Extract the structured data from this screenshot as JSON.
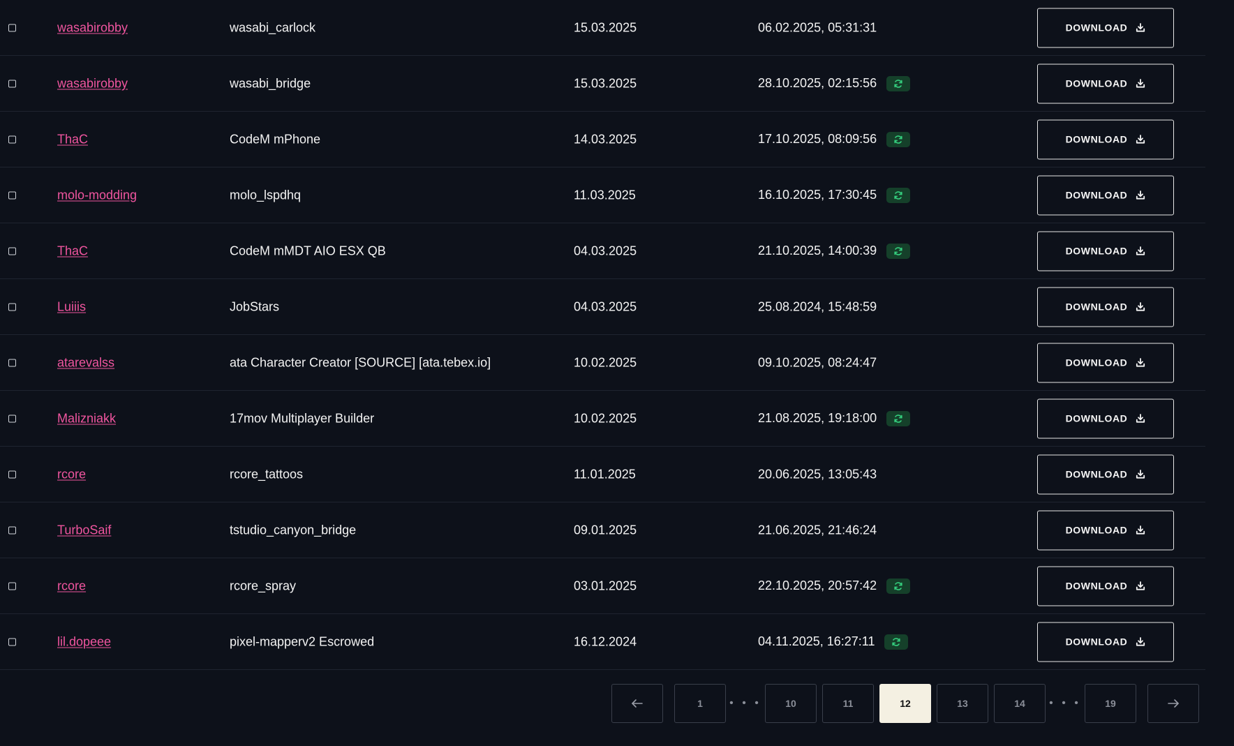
{
  "table": {
    "rows": [
      {
        "author": "wasabirobby",
        "name": "wasabi_carlock",
        "date": "15.03.2025",
        "updated": "06.02.2025, 05:31:31",
        "synced": false,
        "download_label": "DOWNLOAD"
      },
      {
        "author": "wasabirobby",
        "name": "wasabi_bridge",
        "date": "15.03.2025",
        "updated": "28.10.2025, 02:15:56",
        "synced": true,
        "download_label": "DOWNLOAD"
      },
      {
        "author": "ThaC",
        "name": "CodeM mPhone",
        "date": "14.03.2025",
        "updated": "17.10.2025, 08:09:56",
        "synced": true,
        "download_label": "DOWNLOAD"
      },
      {
        "author": "molo-modding",
        "name": "molo_lspdhq",
        "date": "11.03.2025",
        "updated": "16.10.2025, 17:30:45",
        "synced": true,
        "download_label": "DOWNLOAD"
      },
      {
        "author": "ThaC",
        "name": "CodeM mMDT AIO ESX QB",
        "date": "04.03.2025",
        "updated": "21.10.2025, 14:00:39",
        "synced": true,
        "download_label": "DOWNLOAD"
      },
      {
        "author": "Luiiis",
        "name": "JobStars",
        "date": "04.03.2025",
        "updated": "25.08.2024, 15:48:59",
        "synced": false,
        "download_label": "DOWNLOAD"
      },
      {
        "author": "atarevalss",
        "name": "ata Character Creator [SOURCE] [ata.tebex.io]",
        "date": "10.02.2025",
        "updated": "09.10.2025, 08:24:47",
        "synced": false,
        "download_label": "DOWNLOAD"
      },
      {
        "author": "Malizniakk",
        "name": "17mov Multiplayer Builder",
        "date": "10.02.2025",
        "updated": "21.08.2025, 19:18:00",
        "synced": true,
        "download_label": "DOWNLOAD"
      },
      {
        "author": "rcore",
        "name": "rcore_tattoos",
        "date": "11.01.2025",
        "updated": "20.06.2025, 13:05:43",
        "synced": false,
        "download_label": "DOWNLOAD"
      },
      {
        "author": "TurboSaif",
        "name": "tstudio_canyon_bridge",
        "date": "09.01.2025",
        "updated": "21.06.2025, 21:46:24",
        "synced": false,
        "download_label": "DOWNLOAD"
      },
      {
        "author": "rcore",
        "name": "rcore_spray",
        "date": "03.01.2025",
        "updated": "22.10.2025, 20:57:42",
        "synced": true,
        "download_label": "DOWNLOAD"
      },
      {
        "author": "lil.dopeee",
        "name": "pixel-mapperv2 Escrowed",
        "date": "16.12.2024",
        "updated": "04.11.2025, 16:27:11",
        "synced": true,
        "download_label": "DOWNLOAD"
      }
    ]
  },
  "pagination": {
    "prev_icon": "arrow-left-icon",
    "next_icon": "arrow-right-icon",
    "items": [
      {
        "type": "page",
        "label": "1",
        "active": false
      },
      {
        "type": "ellipsis",
        "label": "• • •"
      },
      {
        "type": "page",
        "label": "10",
        "active": false
      },
      {
        "type": "page",
        "label": "11",
        "active": false
      },
      {
        "type": "page",
        "label": "12",
        "active": true
      },
      {
        "type": "page",
        "label": "13",
        "active": false
      },
      {
        "type": "page",
        "label": "14",
        "active": false
      },
      {
        "type": "ellipsis",
        "label": "• • •"
      },
      {
        "type": "page",
        "label": "19",
        "active": false
      }
    ]
  },
  "colors": {
    "background": "#0d111a",
    "author_link": "#f0559f",
    "sync_badge_bg": "#15402a",
    "sync_icon": "#35d07f",
    "active_page_bg": "#f4f0e2"
  },
  "icons": {
    "download": "download-icon",
    "sync": "sync-icon",
    "checkbox": "checkbox"
  }
}
